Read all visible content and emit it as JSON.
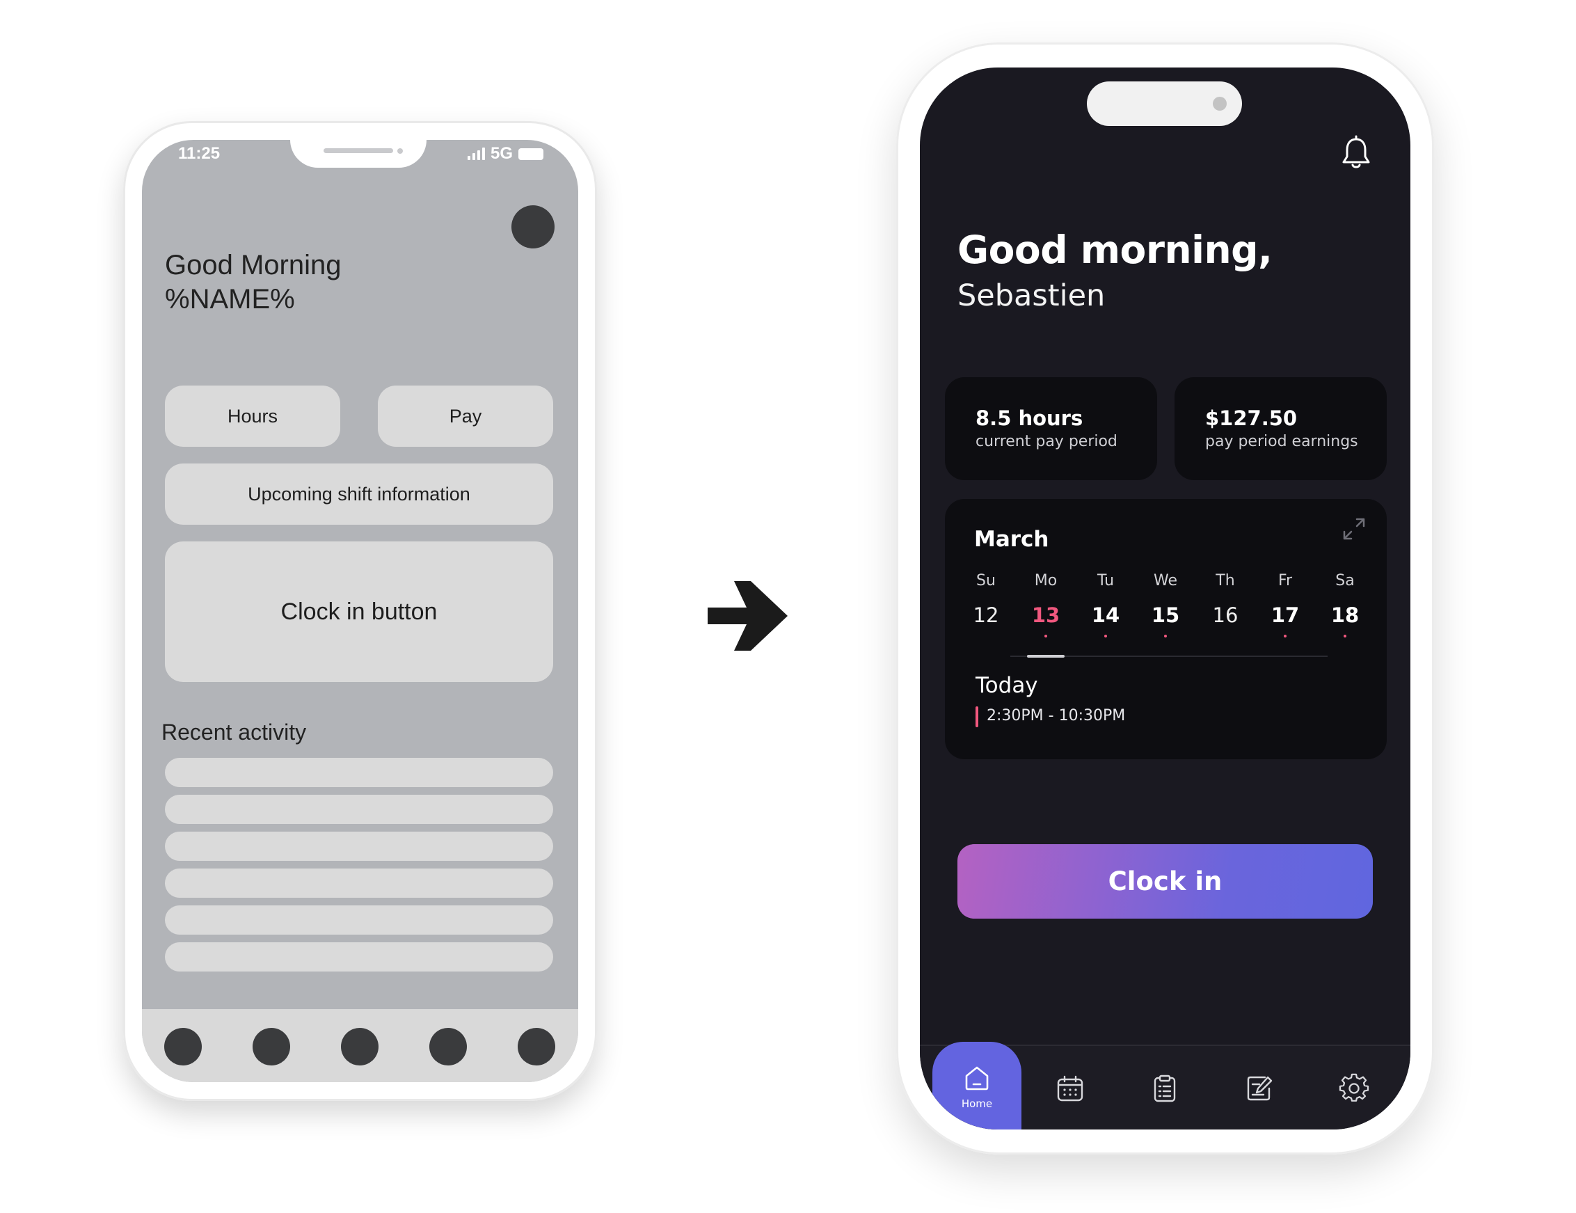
{
  "wireframe": {
    "status": {
      "time": "11:25",
      "network": "5G"
    },
    "greeting": {
      "line1": "Good Morning",
      "line2": "%NAME%"
    },
    "hours_label": "Hours",
    "pay_label": "Pay",
    "shift_label": "Upcoming shift information",
    "clock_label": "Clock in button",
    "recent_label": "Recent activity"
  },
  "app": {
    "greeting": "Good morning,",
    "name": "Sebastien",
    "stats": [
      {
        "value": "8.5 hours",
        "label": "current pay period"
      },
      {
        "value": "$127.50",
        "label": "pay period earnings"
      }
    ],
    "calendar": {
      "month": "March",
      "days": [
        {
          "dow": "Su",
          "num": "12",
          "style": "normal",
          "dot": false
        },
        {
          "dow": "Mo",
          "num": "13",
          "style": "active",
          "dot": true
        },
        {
          "dow": "Tu",
          "num": "14",
          "style": "bold",
          "dot": true
        },
        {
          "dow": "We",
          "num": "15",
          "style": "bold",
          "dot": true
        },
        {
          "dow": "Th",
          "num": "16",
          "style": "normal",
          "dot": false
        },
        {
          "dow": "Fr",
          "num": "17",
          "style": "bold",
          "dot": true
        },
        {
          "dow": "Sa",
          "num": "18",
          "style": "bold",
          "dot": true
        }
      ],
      "today_label": "Today",
      "shift_time": "2:30PM - 10:30PM"
    },
    "clock_in_label": "Clock in",
    "tabs": [
      {
        "icon": "home-icon",
        "label": "Home",
        "active": true
      },
      {
        "icon": "calendar-icon",
        "label": "",
        "active": false
      },
      {
        "icon": "clipboard-icon",
        "label": "",
        "active": false
      },
      {
        "icon": "edit-note-icon",
        "label": "",
        "active": false
      },
      {
        "icon": "gear-icon",
        "label": "",
        "active": false
      }
    ],
    "colors": {
      "background": "#1a1921",
      "accent": "#6364e0",
      "highlight": "#f1587f",
      "card": "#0d0d11"
    }
  }
}
